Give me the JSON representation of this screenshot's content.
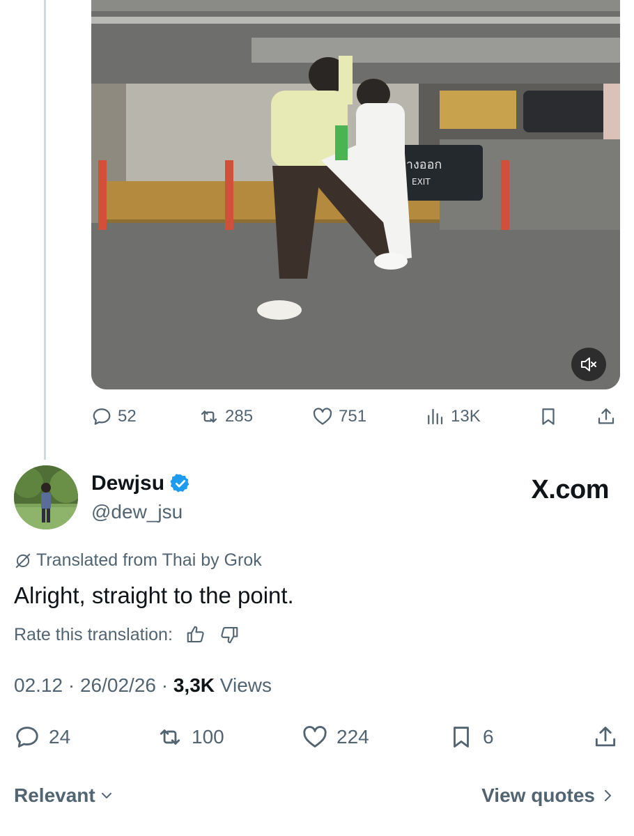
{
  "video": {
    "sign_text": "ทางออก",
    "sign_subtext": "EXIT",
    "mute_icon": "speaker-muted-icon"
  },
  "top_actions": {
    "replies": "52",
    "reposts": "285",
    "likes": "751",
    "views": "13K"
  },
  "profile": {
    "display_name": "Dewjsu",
    "handle": "@dew_jsu",
    "verified_color": "#1d9bf0"
  },
  "watermark": "X.com",
  "tweet": {
    "translated_label": "Translated from Thai by Grok",
    "text": "Alright, straight to the point.",
    "rate_label": "Rate this translation:",
    "time": "02.12",
    "date": "26/02/26",
    "views_count": "3,3K",
    "views_label": "Views",
    "sep": "·"
  },
  "bottom_actions": {
    "replies": "24",
    "reposts": "100",
    "likes": "224",
    "bookmarks": "6"
  },
  "footer": {
    "sort_label": "Relevant",
    "quotes_label": "View quotes"
  },
  "colors": {
    "text": "#0f1419",
    "muted": "#536471",
    "thread_line": "#cfd9de"
  }
}
